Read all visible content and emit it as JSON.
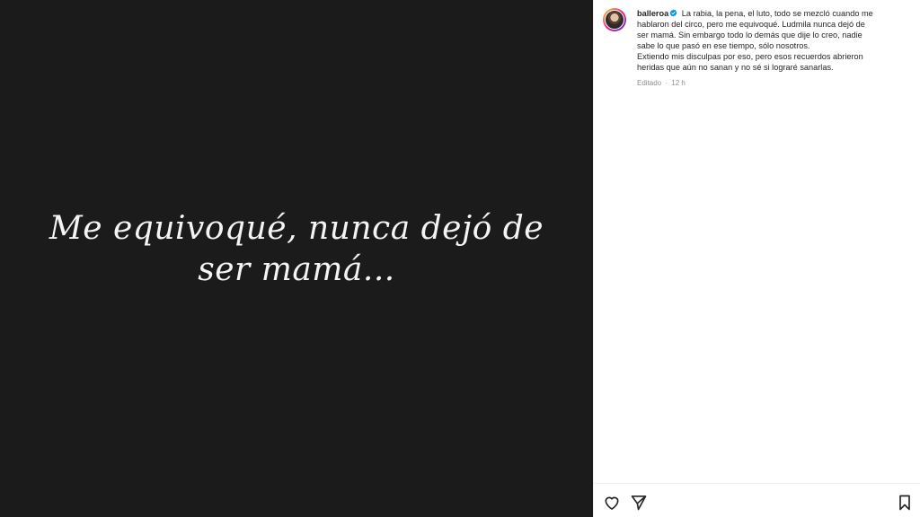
{
  "post": {
    "media_text_line1": "Me equivoqué, nunca dejó de",
    "media_text_line2": "ser mamá..."
  },
  "caption": {
    "username": "balleroa",
    "verified": true,
    "line1": "La rabia, la pena, el luto, todo se mezcló cuando me",
    "line2": "hablaron del circo, pero me equivoqué. Ludmila nunca dejó de",
    "line3": "ser mamá. Sin embargo todo lo demás que dije lo creo, nadie",
    "line4": "sabe lo que pasó en ese tiempo, sólo nosotros.",
    "line5": "Extiendo mis disculpas por eso, pero esos recuerdos abrieron",
    "line6": "heridas que aún no sanan y no sé si lograré sanarlas.",
    "edited_label": "Editado",
    "separator": "·",
    "timestamp": "12 h"
  },
  "actions": {
    "like_icon": "heart-outline-icon",
    "share_icon": "paper-plane-icon",
    "save_icon": "bookmark-outline-icon"
  },
  "colors": {
    "media_background": "#1b1b1b",
    "verified_blue": "#0095f6",
    "secondary_text": "#8e8e8e"
  }
}
